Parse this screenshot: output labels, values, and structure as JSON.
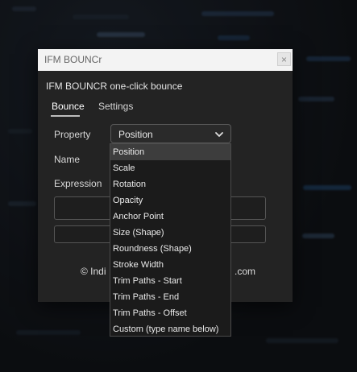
{
  "window": {
    "title": "IFM BOUNCr",
    "close_glyph": "×"
  },
  "panel": {
    "heading": "IFM BOUNCR  one-click bounce"
  },
  "tabs": [
    {
      "label": "Bounce",
      "active": true
    },
    {
      "label": "Settings",
      "active": false
    }
  ],
  "form": {
    "property_label": "Property",
    "property_value": "Position",
    "name_label": "Name",
    "expression_label": "Expression"
  },
  "footer": {
    "left": "© Indi",
    "right": ".com"
  },
  "dropdown": {
    "options": [
      "Position",
      "Scale",
      "Rotation",
      "Opacity",
      "Anchor Point",
      "Size (Shape)",
      "Roundness (Shape)",
      "Stroke Width",
      "Trim Paths - Start",
      "Trim Paths - End",
      "Trim Paths - Offset",
      "Custom (type name below)"
    ],
    "selected_index": 0
  }
}
